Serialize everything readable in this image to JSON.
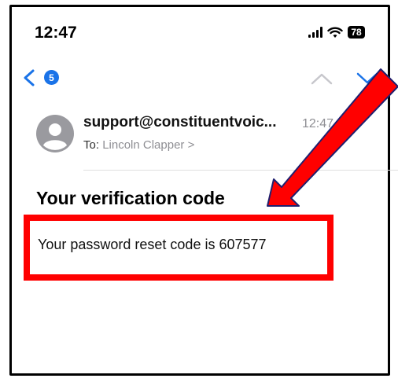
{
  "status_bar": {
    "time": "12:47",
    "battery_level": "78"
  },
  "nav": {
    "unread_badge": "5"
  },
  "message": {
    "sender": "support@constituentvoic...",
    "time": "12:47",
    "to_label": "To:",
    "recipient": "Lincoln Clapper >",
    "subject": "Your verification code",
    "body": "Your password reset code is 607577"
  },
  "colors": {
    "accent_blue": "#1a73e8",
    "annotation_red": "#ff0000",
    "secondary_gray": "#8e8e93"
  }
}
